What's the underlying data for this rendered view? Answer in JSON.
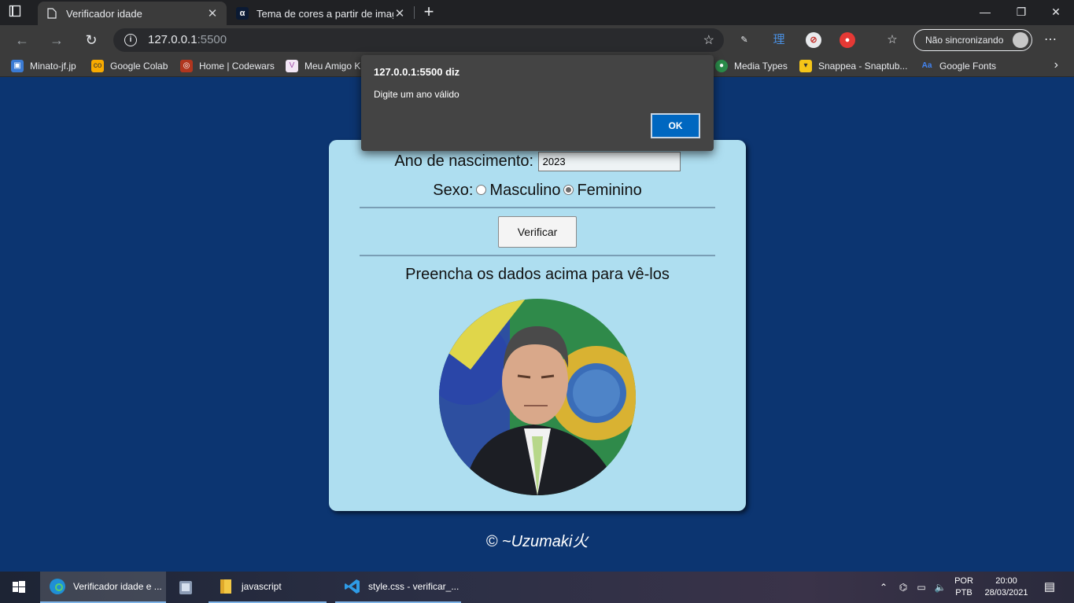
{
  "browser": {
    "tabs": [
      {
        "title": "Verificador idade",
        "active": true
      },
      {
        "title": "Tema de cores a partir de imagem",
        "active": false
      }
    ],
    "url_host": "127.0.0.1",
    "url_port": ":5500",
    "profile_label": "Não sincronizando",
    "bookmarks": [
      {
        "label": "Minato-jf.jp"
      },
      {
        "label": "Google Colab"
      },
      {
        "label": "Home | Codewars"
      },
      {
        "label": "Meu Amigo K"
      },
      {
        "label": "Media Types"
      },
      {
        "label": "Snappea - Snaptub..."
      },
      {
        "label": "Google Fonts"
      }
    ]
  },
  "page": {
    "birth_year_label": "Ano de nascimento:",
    "birth_year_value": "2023",
    "sex_label": "Sexo:",
    "sex_options": [
      "Masculino",
      "Feminino"
    ],
    "sex_selected": "Feminino",
    "verify_button": "Verificar",
    "result_text": "Preencha os dados acima para vê-los",
    "footer": "© ~Uzumaki火"
  },
  "alert": {
    "title": "127.0.0.1:5500 diz",
    "message": "Digite um ano válido",
    "ok_label": "OK"
  },
  "taskbar": {
    "apps": [
      {
        "label": "Verificador idade e ...",
        "icon": "edge-icon"
      },
      {
        "label": "",
        "icon": "app-icon"
      },
      {
        "label": "javascript",
        "icon": "folder-icon"
      },
      {
        "label": "style.css - verificar_...",
        "icon": "vscode-icon"
      }
    ],
    "lang_top": "POR",
    "lang_bottom": "PTB",
    "time": "20:00",
    "date": "28/03/2021"
  },
  "colors": {
    "page_background": "#0c3571",
    "card_background": "#aedef0",
    "dialog_background": "#444444",
    "ok_button": "#0067c0"
  }
}
